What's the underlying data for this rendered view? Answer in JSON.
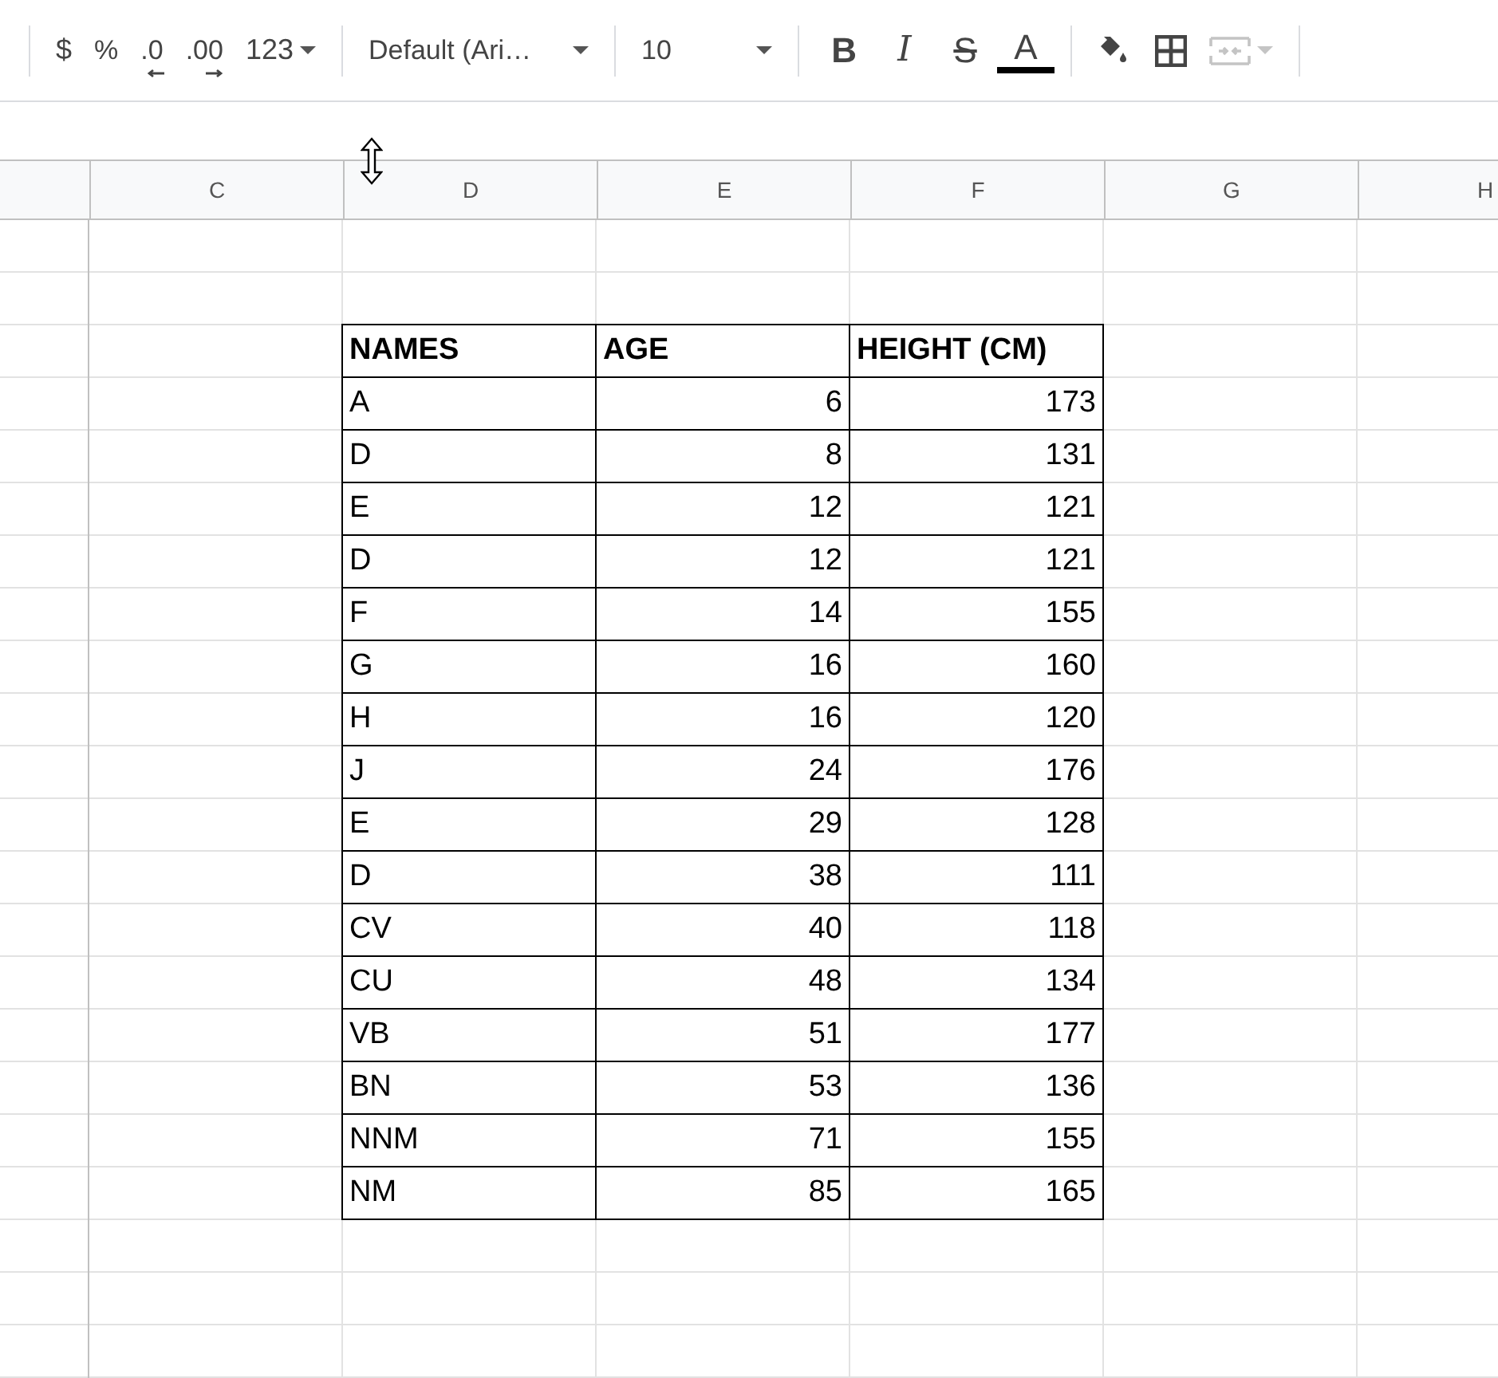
{
  "toolbar": {
    "currency": "$",
    "percent": "%",
    "decrease_decimal": ".0",
    "increase_decimal": ".00",
    "more_formats": "123",
    "font": "Default (Ari…",
    "font_size": "10",
    "bold": "B",
    "italic": "I",
    "strikethrough": "S",
    "text_color": "A",
    "merge_disabled": true
  },
  "columns": [
    "C",
    "D",
    "E",
    "F",
    "G",
    "H"
  ],
  "table": {
    "headers": [
      "NAMES",
      "AGE",
      "HEIGHT (CM)"
    ],
    "rows": [
      [
        "A",
        "6",
        "173"
      ],
      [
        "D",
        "8",
        "131"
      ],
      [
        "E",
        "12",
        "121"
      ],
      [
        "D",
        "12",
        "121"
      ],
      [
        "F",
        "14",
        "155"
      ],
      [
        "G",
        "16",
        "160"
      ],
      [
        "H",
        "16",
        "120"
      ],
      [
        "J",
        "24",
        "176"
      ],
      [
        "E",
        "29",
        "128"
      ],
      [
        "D",
        "38",
        "111"
      ],
      [
        "CV",
        "40",
        "118"
      ],
      [
        "CU",
        "48",
        "134"
      ],
      [
        "VB",
        "51",
        "177"
      ],
      [
        "BN",
        "53",
        "136"
      ],
      [
        "NNM",
        "71",
        "155"
      ],
      [
        "NM",
        "85",
        "165"
      ]
    ]
  }
}
